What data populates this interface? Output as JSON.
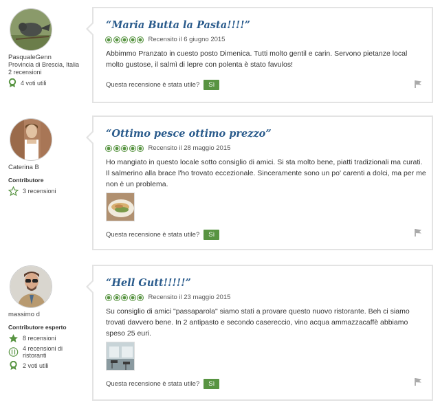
{
  "colors": {
    "accent": "#589442",
    "title": "#2a5b8c",
    "card_border": "#e3e3e3"
  },
  "reviews": [
    {
      "member": {
        "username": "PasqualeGenn",
        "location": "Provincia di Brescia, Italia",
        "reviews_count": "2 recensioni",
        "level": "",
        "stats": [
          {
            "icon": "ribbon-icon",
            "label": "4 voti utili"
          }
        ]
      },
      "title": "“Maria Butta la Pasta!!!!”",
      "rating": 5,
      "date": "Recensito il 6 giugno 2015",
      "text": "Abbimmo Pranzato in cuesto posto Dimenica. Tutti molto gentil e carin. Servono pietanze local molto gustose, il salmì di lepre con polenta è stato favulos!",
      "helpful_question": "Questa recensione è stata utile?",
      "yes_label": "Sì"
    },
    {
      "member": {
        "username": "Caterina B",
        "location": "",
        "reviews_count": "",
        "level": "Contributore",
        "stats": [
          {
            "icon": "star-outline-icon",
            "label": "3 recensioni"
          }
        ]
      },
      "title": "“Ottimo pesce ottimo prezzo”",
      "rating": 5,
      "date": "Recensito il 28 maggio 2015",
      "text": "Ho mangiato in questo locale sotto consiglio di amici. Si sta molto bene, piatti tradizionali ma curati. Il salmerino alla brace l'ho trovato eccezionale. Sinceramente sono un po' carenti a dolci, ma per me non è un problema.",
      "helpful_question": "Questa recensione è stata utile?",
      "yes_label": "Sì"
    },
    {
      "member": {
        "username": "massimo d",
        "location": "",
        "reviews_count": "",
        "level": "Contributore esperto",
        "stats": [
          {
            "icon": "star-filled-icon",
            "label": "8 recensioni"
          },
          {
            "icon": "fork-knife-icon",
            "label": "4 recensioni di ristoranti"
          },
          {
            "icon": "ribbon-icon",
            "label": "2 voti utili"
          }
        ]
      },
      "title": "“Hell Gutt!!!!!”",
      "rating": 5,
      "date": "Recensito il 23 maggio 2015",
      "text": "Su consiglio di amici \"passaparola\" siamo stati a provare questo nuovo ristorante. Beh ci siamo trovati davvero bene. In 2 antipasto e secondo casereccio, vino acqua ammazzacaffè abbiamo speso 25 euri.",
      "helpful_question": "Questa recensione è stata utile?",
      "yes_label": "Sì"
    }
  ]
}
